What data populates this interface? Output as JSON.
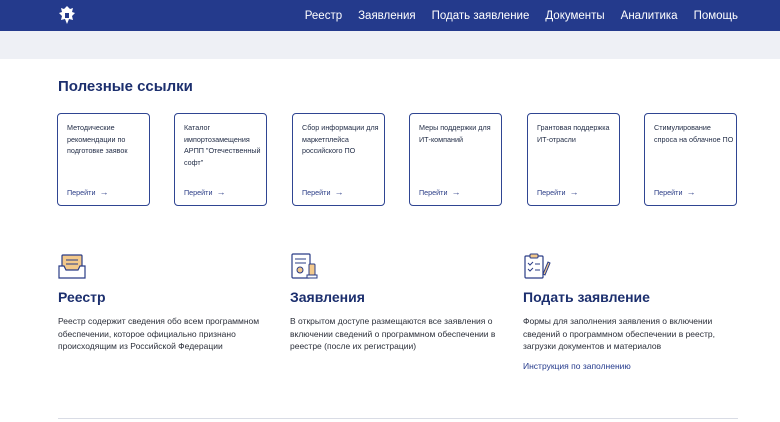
{
  "nav": {
    "items": [
      "Реестр",
      "Заявления",
      "Подать заявление",
      "Документы",
      "Аналитика",
      "Помощь"
    ]
  },
  "useful_links": {
    "title": "Полезные ссылки",
    "cards": [
      {
        "text": "Методические рекомендации по подготовке заявок",
        "link": "Перейти"
      },
      {
        "text": "Каталог импортозамещения АРПП \"Отечественный софт\"",
        "link": "Перейти"
      },
      {
        "text": "Сбор информации для маркетплейса российского ПО",
        "link": "Перейти"
      },
      {
        "text": "Меры поддержки для ИТ-компаний",
        "link": "Перейти"
      },
      {
        "text": "Грантовая поддержка ИТ-отрасли",
        "link": "Перейти"
      },
      {
        "text": "Стимулирование спроса на облачное ПО",
        "link": "Перейти"
      }
    ]
  },
  "features": [
    {
      "icon": "registry-icon",
      "title": "Реестр",
      "text": "Реестр содержит сведения обо всем программном обеспечении, которое официально признано происходящим из  Российской Федерации"
    },
    {
      "icon": "applications-icon",
      "title": "Заявления",
      "text": "В открытом доступе размещаются все заявления о включении сведений о программном обеспечении в реестре (после их регистрации)"
    },
    {
      "icon": "submit-application-icon",
      "title": "Подать заявление",
      "text": "Формы для заполнения заявления о включении сведений о программном обеспечении в реестр, загрузки документов и материалов",
      "link": "Инструкция по заполнению"
    }
  ],
  "colors": {
    "header": "#243a8c",
    "accent": "#1c2f6e",
    "band": "#eef0f5"
  }
}
